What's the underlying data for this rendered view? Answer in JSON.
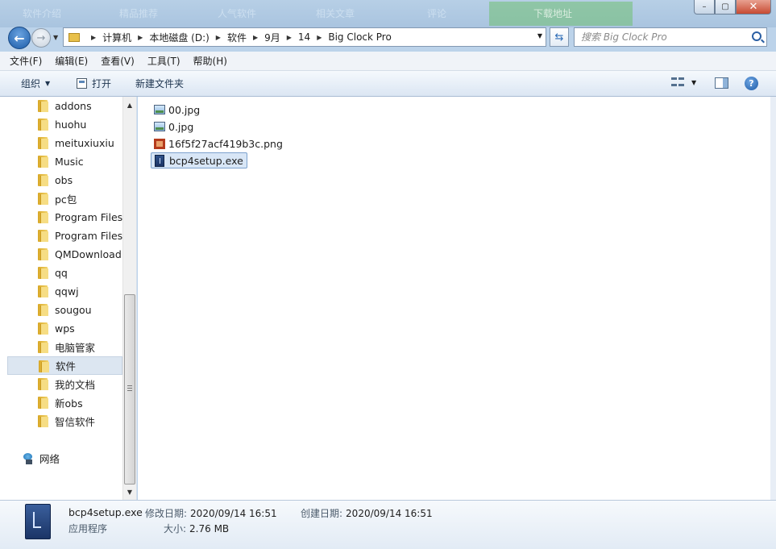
{
  "background_tabs": [
    "软件介绍",
    "精品推荐",
    "人气软件",
    "相关文章",
    "评论",
    "下载地址"
  ],
  "window": {
    "min_icon": "minimize-icon",
    "max_icon": "maximize-icon",
    "close_icon": "close-icon"
  },
  "address": {
    "crumbs": [
      "计算机",
      "本地磁盘 (D:)",
      "软件",
      "9月",
      "14",
      "Big Clock Pro"
    ]
  },
  "search": {
    "placeholder": "搜索 Big Clock Pro"
  },
  "menu": [
    "文件(F)",
    "编辑(E)",
    "查看(V)",
    "工具(T)",
    "帮助(H)"
  ],
  "toolbar": {
    "organize": "组织",
    "open": "打开",
    "new_folder": "新建文件夹"
  },
  "nav_tree": [
    "addons",
    "huohu",
    "meituxiuxiu",
    "Music",
    "obs",
    "pc包",
    "Program Files",
    "Program Files",
    "QMDownload",
    "qq",
    "qqwj",
    "sougou",
    "wps",
    "电脑管家",
    "软件",
    "我的文档",
    "新obs",
    "智信软件"
  ],
  "nav_selected_index": 14,
  "network_label": "网络",
  "files": [
    {
      "name": "00.jpg",
      "icon": "image-file-icon"
    },
    {
      "name": "0.jpg",
      "icon": "image-file-icon"
    },
    {
      "name": "16f5f27acf419b3c.png",
      "icon": "png-file-icon"
    },
    {
      "name": "bcp4setup.exe",
      "icon": "exe-file-icon"
    }
  ],
  "selected_file_index": 3,
  "details": {
    "name": "bcp4setup.exe",
    "type": "应用程序",
    "modified_label": "修改日期:",
    "modified_value": "2020/09/14 16:51",
    "size_label": "大小:",
    "size_value": "2.76 MB",
    "created_label": "创建日期:",
    "created_value": "2020/09/14 16:51"
  }
}
